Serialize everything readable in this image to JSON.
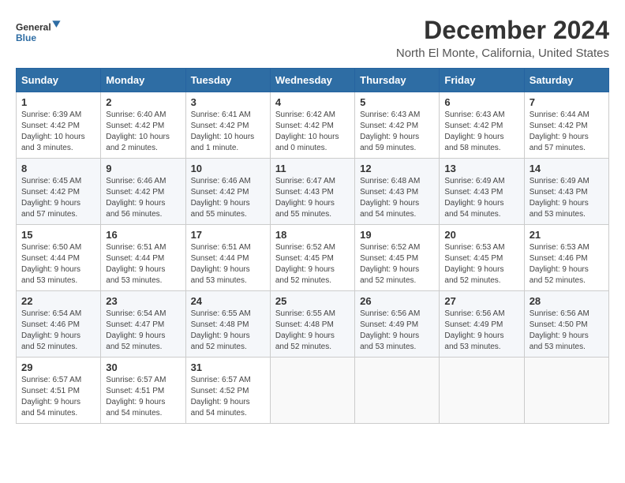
{
  "header": {
    "logo_line1": "General",
    "logo_line2": "Blue",
    "main_title": "December 2024",
    "subtitle": "North El Monte, California, United States"
  },
  "calendar": {
    "headers": [
      "Sunday",
      "Monday",
      "Tuesday",
      "Wednesday",
      "Thursday",
      "Friday",
      "Saturday"
    ],
    "weeks": [
      [
        {
          "day": "1",
          "info": "Sunrise: 6:39 AM\nSunset: 4:42 PM\nDaylight: 10 hours\nand 3 minutes."
        },
        {
          "day": "2",
          "info": "Sunrise: 6:40 AM\nSunset: 4:42 PM\nDaylight: 10 hours\nand 2 minutes."
        },
        {
          "day": "3",
          "info": "Sunrise: 6:41 AM\nSunset: 4:42 PM\nDaylight: 10 hours\nand 1 minute."
        },
        {
          "day": "4",
          "info": "Sunrise: 6:42 AM\nSunset: 4:42 PM\nDaylight: 10 hours\nand 0 minutes."
        },
        {
          "day": "5",
          "info": "Sunrise: 6:43 AM\nSunset: 4:42 PM\nDaylight: 9 hours\nand 59 minutes."
        },
        {
          "day": "6",
          "info": "Sunrise: 6:43 AM\nSunset: 4:42 PM\nDaylight: 9 hours\nand 58 minutes."
        },
        {
          "day": "7",
          "info": "Sunrise: 6:44 AM\nSunset: 4:42 PM\nDaylight: 9 hours\nand 57 minutes."
        }
      ],
      [
        {
          "day": "8",
          "info": "Sunrise: 6:45 AM\nSunset: 4:42 PM\nDaylight: 9 hours\nand 57 minutes."
        },
        {
          "day": "9",
          "info": "Sunrise: 6:46 AM\nSunset: 4:42 PM\nDaylight: 9 hours\nand 56 minutes."
        },
        {
          "day": "10",
          "info": "Sunrise: 6:46 AM\nSunset: 4:42 PM\nDaylight: 9 hours\nand 55 minutes."
        },
        {
          "day": "11",
          "info": "Sunrise: 6:47 AM\nSunset: 4:43 PM\nDaylight: 9 hours\nand 55 minutes."
        },
        {
          "day": "12",
          "info": "Sunrise: 6:48 AM\nSunset: 4:43 PM\nDaylight: 9 hours\nand 54 minutes."
        },
        {
          "day": "13",
          "info": "Sunrise: 6:49 AM\nSunset: 4:43 PM\nDaylight: 9 hours\nand 54 minutes."
        },
        {
          "day": "14",
          "info": "Sunrise: 6:49 AM\nSunset: 4:43 PM\nDaylight: 9 hours\nand 53 minutes."
        }
      ],
      [
        {
          "day": "15",
          "info": "Sunrise: 6:50 AM\nSunset: 4:44 PM\nDaylight: 9 hours\nand 53 minutes."
        },
        {
          "day": "16",
          "info": "Sunrise: 6:51 AM\nSunset: 4:44 PM\nDaylight: 9 hours\nand 53 minutes."
        },
        {
          "day": "17",
          "info": "Sunrise: 6:51 AM\nSunset: 4:44 PM\nDaylight: 9 hours\nand 53 minutes."
        },
        {
          "day": "18",
          "info": "Sunrise: 6:52 AM\nSunset: 4:45 PM\nDaylight: 9 hours\nand 52 minutes."
        },
        {
          "day": "19",
          "info": "Sunrise: 6:52 AM\nSunset: 4:45 PM\nDaylight: 9 hours\nand 52 minutes."
        },
        {
          "day": "20",
          "info": "Sunrise: 6:53 AM\nSunset: 4:45 PM\nDaylight: 9 hours\nand 52 minutes."
        },
        {
          "day": "21",
          "info": "Sunrise: 6:53 AM\nSunset: 4:46 PM\nDaylight: 9 hours\nand 52 minutes."
        }
      ],
      [
        {
          "day": "22",
          "info": "Sunrise: 6:54 AM\nSunset: 4:46 PM\nDaylight: 9 hours\nand 52 minutes."
        },
        {
          "day": "23",
          "info": "Sunrise: 6:54 AM\nSunset: 4:47 PM\nDaylight: 9 hours\nand 52 minutes."
        },
        {
          "day": "24",
          "info": "Sunrise: 6:55 AM\nSunset: 4:48 PM\nDaylight: 9 hours\nand 52 minutes."
        },
        {
          "day": "25",
          "info": "Sunrise: 6:55 AM\nSunset: 4:48 PM\nDaylight: 9 hours\nand 52 minutes."
        },
        {
          "day": "26",
          "info": "Sunrise: 6:56 AM\nSunset: 4:49 PM\nDaylight: 9 hours\nand 53 minutes."
        },
        {
          "day": "27",
          "info": "Sunrise: 6:56 AM\nSunset: 4:49 PM\nDaylight: 9 hours\nand 53 minutes."
        },
        {
          "day": "28",
          "info": "Sunrise: 6:56 AM\nSunset: 4:50 PM\nDaylight: 9 hours\nand 53 minutes."
        }
      ],
      [
        {
          "day": "29",
          "info": "Sunrise: 6:57 AM\nSunset: 4:51 PM\nDaylight: 9 hours\nand 54 minutes."
        },
        {
          "day": "30",
          "info": "Sunrise: 6:57 AM\nSunset: 4:51 PM\nDaylight: 9 hours\nand 54 minutes."
        },
        {
          "day": "31",
          "info": "Sunrise: 6:57 AM\nSunset: 4:52 PM\nDaylight: 9 hours\nand 54 minutes."
        },
        {
          "day": "",
          "info": ""
        },
        {
          "day": "",
          "info": ""
        },
        {
          "day": "",
          "info": ""
        },
        {
          "day": "",
          "info": ""
        }
      ]
    ]
  }
}
